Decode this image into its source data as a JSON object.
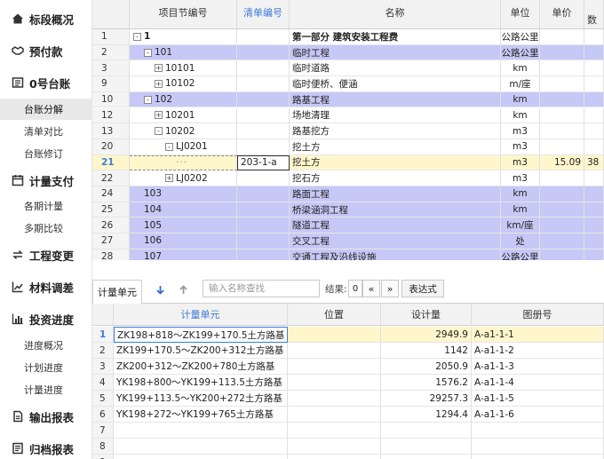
{
  "sidebar": {
    "sections": [
      {
        "label": "标段概况",
        "icon": "home-icon"
      },
      {
        "label": "预付款",
        "icon": "handshake-icon"
      },
      {
        "label": "0号台账",
        "icon": "ledger-icon"
      },
      {
        "label": "计量支付",
        "icon": "calendar-icon"
      },
      {
        "label": "工程变更",
        "icon": "swap-icon"
      },
      {
        "label": "材料调差",
        "icon": "trend-icon"
      },
      {
        "label": "投资进度",
        "icon": "bar-chart-icon"
      },
      {
        "label": "输出报表",
        "icon": "report-icon"
      },
      {
        "label": "归档报表",
        "icon": "archive-icon"
      }
    ],
    "ledger_items": [
      "台账分解",
      "清单对比",
      "台账修订"
    ],
    "payment_items": [
      "各期计量",
      "多期比较"
    ],
    "progress_items": [
      "进度概况",
      "计划进度",
      "计量进度"
    ]
  },
  "top_grid": {
    "headers": [
      "项目节编号",
      "清单编号",
      "名称",
      "单位",
      "单价",
      "数"
    ],
    "rows": [
      {
        "num": "1",
        "toggle": "-",
        "code": "1",
        "bill": "",
        "name": "第一部分 建筑安装工程费",
        "unit": "公路公里",
        "price": "",
        "qty": "",
        "bg": "white",
        "bold": true,
        "indent": 0
      },
      {
        "num": "2",
        "toggle": "-",
        "code": "101",
        "bill": "",
        "name": "临时工程",
        "unit": "公路公里",
        "price": "",
        "qty": "",
        "bg": "blue",
        "bold": false,
        "indent": 1
      },
      {
        "num": "3",
        "toggle": "+",
        "code": "10101",
        "bill": "",
        "name": "临时道路",
        "unit": "km",
        "price": "",
        "qty": "",
        "bg": "white",
        "bold": false,
        "indent": 2
      },
      {
        "num": "9",
        "toggle": "+",
        "code": "10102",
        "bill": "",
        "name": "临时便桥、便涵",
        "unit": "m/座",
        "price": "",
        "qty": "",
        "bg": "white",
        "bold": false,
        "indent": 2
      },
      {
        "num": "10",
        "toggle": "-",
        "code": "102",
        "bill": "",
        "name": "路基工程",
        "unit": "km",
        "price": "",
        "qty": "",
        "bg": "blue",
        "bold": false,
        "indent": 1
      },
      {
        "num": "12",
        "toggle": "+",
        "code": "10201",
        "bill": "",
        "name": "场地清理",
        "unit": "km",
        "price": "",
        "qty": "",
        "bg": "white",
        "bold": false,
        "indent": 2
      },
      {
        "num": "13",
        "toggle": "-",
        "code": "10202",
        "bill": "",
        "name": "路基挖方",
        "unit": "m3",
        "price": "",
        "qty": "",
        "bg": "white",
        "bold": false,
        "indent": 2
      },
      {
        "num": "20",
        "toggle": "-",
        "code": "LJ0201",
        "bill": "",
        "name": "挖土方",
        "unit": "m3",
        "price": "",
        "qty": "",
        "bg": "white",
        "bold": false,
        "indent": 3
      },
      {
        "num": "21",
        "toggle": "",
        "code": "",
        "bill": "203-1-a",
        "name": "挖土方",
        "unit": "m3",
        "price": "15.09",
        "qty": "38",
        "bg": "yellow",
        "bold": false,
        "indent": 4,
        "selected": true
      },
      {
        "num": "22",
        "toggle": "+",
        "code": "LJ0202",
        "bill": "",
        "name": "挖石方",
        "unit": "m3",
        "price": "",
        "qty": "",
        "bg": "white",
        "bold": false,
        "indent": 3
      },
      {
        "num": "24",
        "toggle": "",
        "code": "103",
        "bill": "",
        "name": "路面工程",
        "unit": "km",
        "price": "",
        "qty": "",
        "bg": "blue",
        "bold": false,
        "indent": 1
      },
      {
        "num": "25",
        "toggle": "",
        "code": "104",
        "bill": "",
        "name": "桥梁涵洞工程",
        "unit": "km",
        "price": "",
        "qty": "",
        "bg": "blue",
        "bold": false,
        "indent": 1
      },
      {
        "num": "26",
        "toggle": "",
        "code": "105",
        "bill": "",
        "name": "隧道工程",
        "unit": "km/座",
        "price": "",
        "qty": "",
        "bg": "blue",
        "bold": false,
        "indent": 1
      },
      {
        "num": "27",
        "toggle": "",
        "code": "106",
        "bill": "",
        "name": "交叉工程",
        "unit": "处",
        "price": "",
        "qty": "",
        "bg": "blue",
        "bold": false,
        "indent": 1
      },
      {
        "num": "28",
        "toggle": "",
        "code": "107",
        "bill": "",
        "name": "交通工程及沿线设施",
        "unit": "公路公里",
        "price": "",
        "qty": "",
        "bg": "blue",
        "bold": false,
        "indent": 1
      }
    ]
  },
  "toolbar": {
    "tab_label": "计量单元",
    "search_placeholder": "输入名称查找",
    "result_label": "结果:",
    "result_count": "0",
    "prev_label": "«",
    "next_label": "»",
    "expression_label": "表达式"
  },
  "bottom_grid": {
    "headers": [
      "计量单元",
      "位置",
      "设计量",
      "图册号"
    ],
    "rows": [
      {
        "num": "1",
        "unit": "ZK198+818～ZK199+170.5土方路基",
        "pos": "",
        "qty": "2949.9",
        "book": "A-a1-1-1",
        "selected": true
      },
      {
        "num": "2",
        "unit": "ZK199+170.5～ZK200+312土方路基",
        "pos": "",
        "qty": "1142",
        "book": "A-a1-1-2"
      },
      {
        "num": "3",
        "unit": "ZK200+312～ZK200+780土方路基",
        "pos": "",
        "qty": "2050.9",
        "book": "A-a1-1-3"
      },
      {
        "num": "4",
        "unit": "YK198+800～YK199+113.5土方路基",
        "pos": "",
        "qty": "1576.2",
        "book": "A-a1-1-4"
      },
      {
        "num": "5",
        "unit": "YK199+113.5～YK200+272土方路基",
        "pos": "",
        "qty": "29257.3",
        "book": "A-a1-1-5"
      },
      {
        "num": "6",
        "unit": "YK198+272～YK199+765土方路基",
        "pos": "",
        "qty": "1294.4",
        "book": "A-a1-1-6"
      },
      {
        "num": "7",
        "unit": "",
        "pos": "",
        "qty": "",
        "book": ""
      },
      {
        "num": "8",
        "unit": "",
        "pos": "",
        "qty": "",
        "book": ""
      },
      {
        "num": "9",
        "unit": "",
        "pos": "",
        "qty": "",
        "book": ""
      }
    ]
  },
  "colors": {
    "blue_row": "#c6c8f6",
    "yellow_row": "#fff6cc",
    "accent": "#3d7bd8"
  }
}
